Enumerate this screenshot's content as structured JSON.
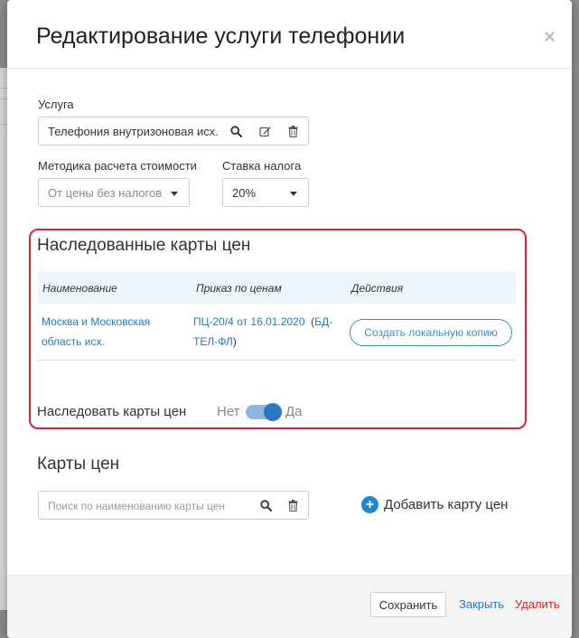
{
  "modal": {
    "title": "Редактирование услуги телефонии",
    "close_glyph": "×"
  },
  "service": {
    "label": "Услуга",
    "value": "Телефония внутризоновая исх."
  },
  "cost_method": {
    "label": "Методика расчета стоимости",
    "value": "От цены без налогов"
  },
  "tax_rate": {
    "label": "Ставка налога",
    "value": "20%"
  },
  "inherited": {
    "title": "Наследованные карты цен",
    "columns": [
      "Наименование",
      "Приказ по ценам",
      "Действия"
    ],
    "rows": [
      {
        "name_line1": "Москва и Московская",
        "name_line2": "область исх.",
        "order_link": "ПЦ-20/4 от 16.01.2020",
        "order_paren_open": "(",
        "order_code_line1": "БД-",
        "order_code_line2": "ТЕЛ-ФЛ",
        "order_paren_close": ")",
        "action": "Создать локальную копию"
      }
    ],
    "toggle": {
      "label": "Наследовать карты цен",
      "off_label": "Нет",
      "on_label": "Да",
      "state": "on"
    }
  },
  "price_cards": {
    "title": "Карты цен",
    "search_placeholder": "Поиск по наименованию карты цен",
    "add_plus": "+",
    "add_label": "Добавить карту цен"
  },
  "footer": {
    "save": "Сохранить",
    "close": "Закрыть",
    "delete": "Удалить"
  },
  "colors": {
    "accent": "#1a7bc9",
    "highlight_border": "#d9232f",
    "delete": "#e02020"
  },
  "icons": [
    "search-icon",
    "edit-icon",
    "trash-icon",
    "plus-circle-icon",
    "close-icon",
    "caret-down-icon"
  ]
}
